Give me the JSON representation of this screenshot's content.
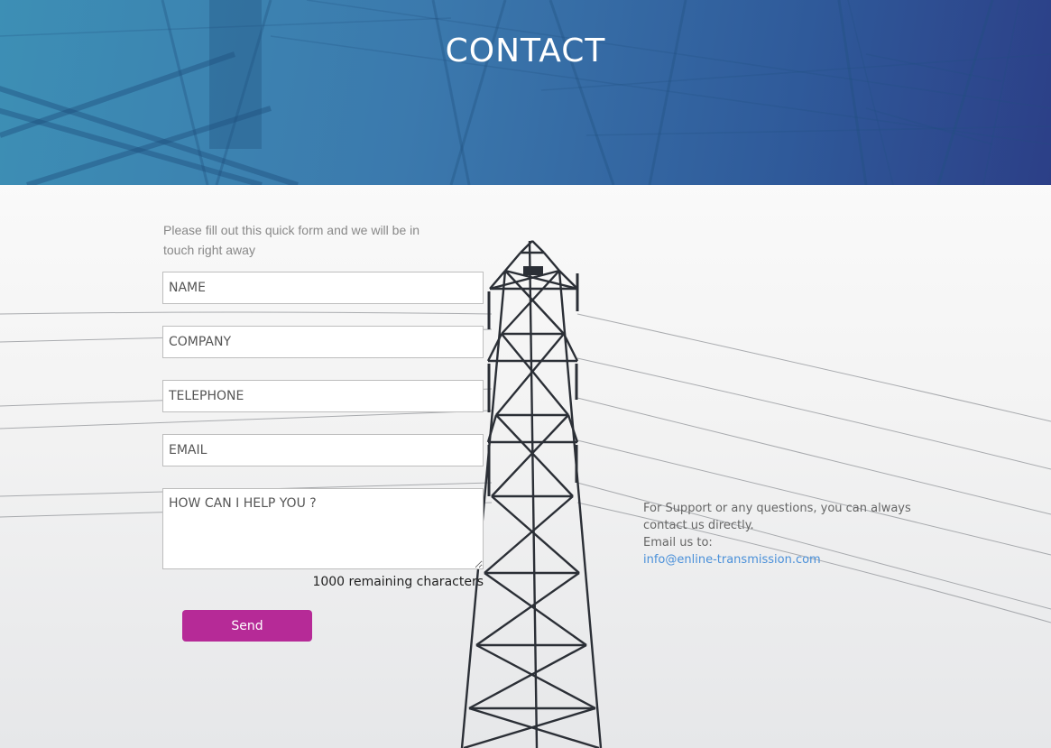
{
  "header": {
    "title": "CONTACT"
  },
  "form": {
    "intro": "Please fill out this quick form and we will be in touch right away",
    "name_placeholder": "NAME",
    "company_placeholder": "COMPANY",
    "telephone_placeholder": "TELEPHONE",
    "email_placeholder": "EMAIL",
    "message_placeholder": "HOW CAN I HELP YOU ?",
    "remaining_characters": "1000 remaining characters",
    "send_label": "Send"
  },
  "info": {
    "line1": "For Support or any questions, you can always contact us directly.",
    "line2": "Email us to:",
    "email": "info@enline-transmission.com"
  },
  "colors": {
    "header_gradient_start": "#3d8fb5",
    "header_gradient_end": "#2c3f87",
    "send_button": "#b62a97",
    "link": "#4a90d9"
  }
}
